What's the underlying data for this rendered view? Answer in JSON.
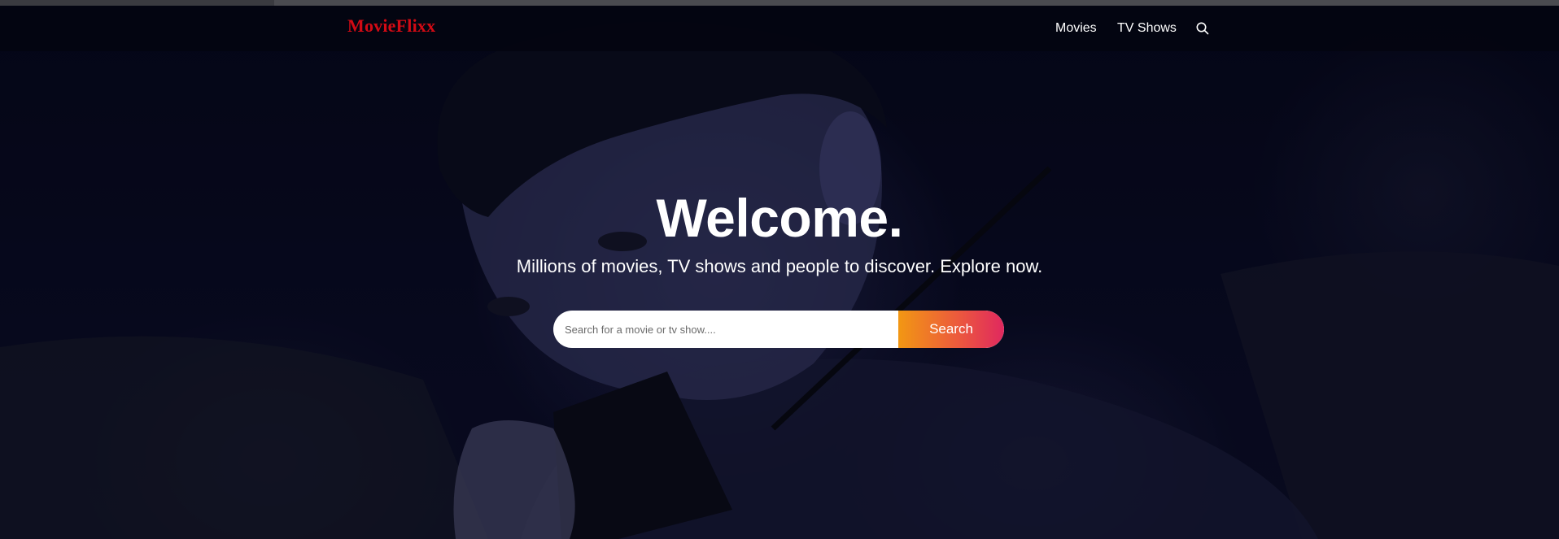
{
  "header": {
    "logo": "MovieFlixx",
    "nav": [
      {
        "label": "Movies"
      },
      {
        "label": "TV Shows"
      }
    ],
    "search_icon": "search-icon"
  },
  "hero": {
    "title": "Welcome.",
    "subtitle": "Millions of movies, TV shows and people to discover. Explore now.",
    "search": {
      "placeholder": "Search for a movie or tv show....",
      "value": "",
      "button_label": "Search"
    },
    "backdrop_image": "man-with-walkie-talkie"
  },
  "colors": {
    "logo": "#d10a14",
    "nav_background": "#050612",
    "button_gradient_start": "#f29713",
    "button_gradient_end": "#e0285f",
    "text": "#ffffff"
  }
}
